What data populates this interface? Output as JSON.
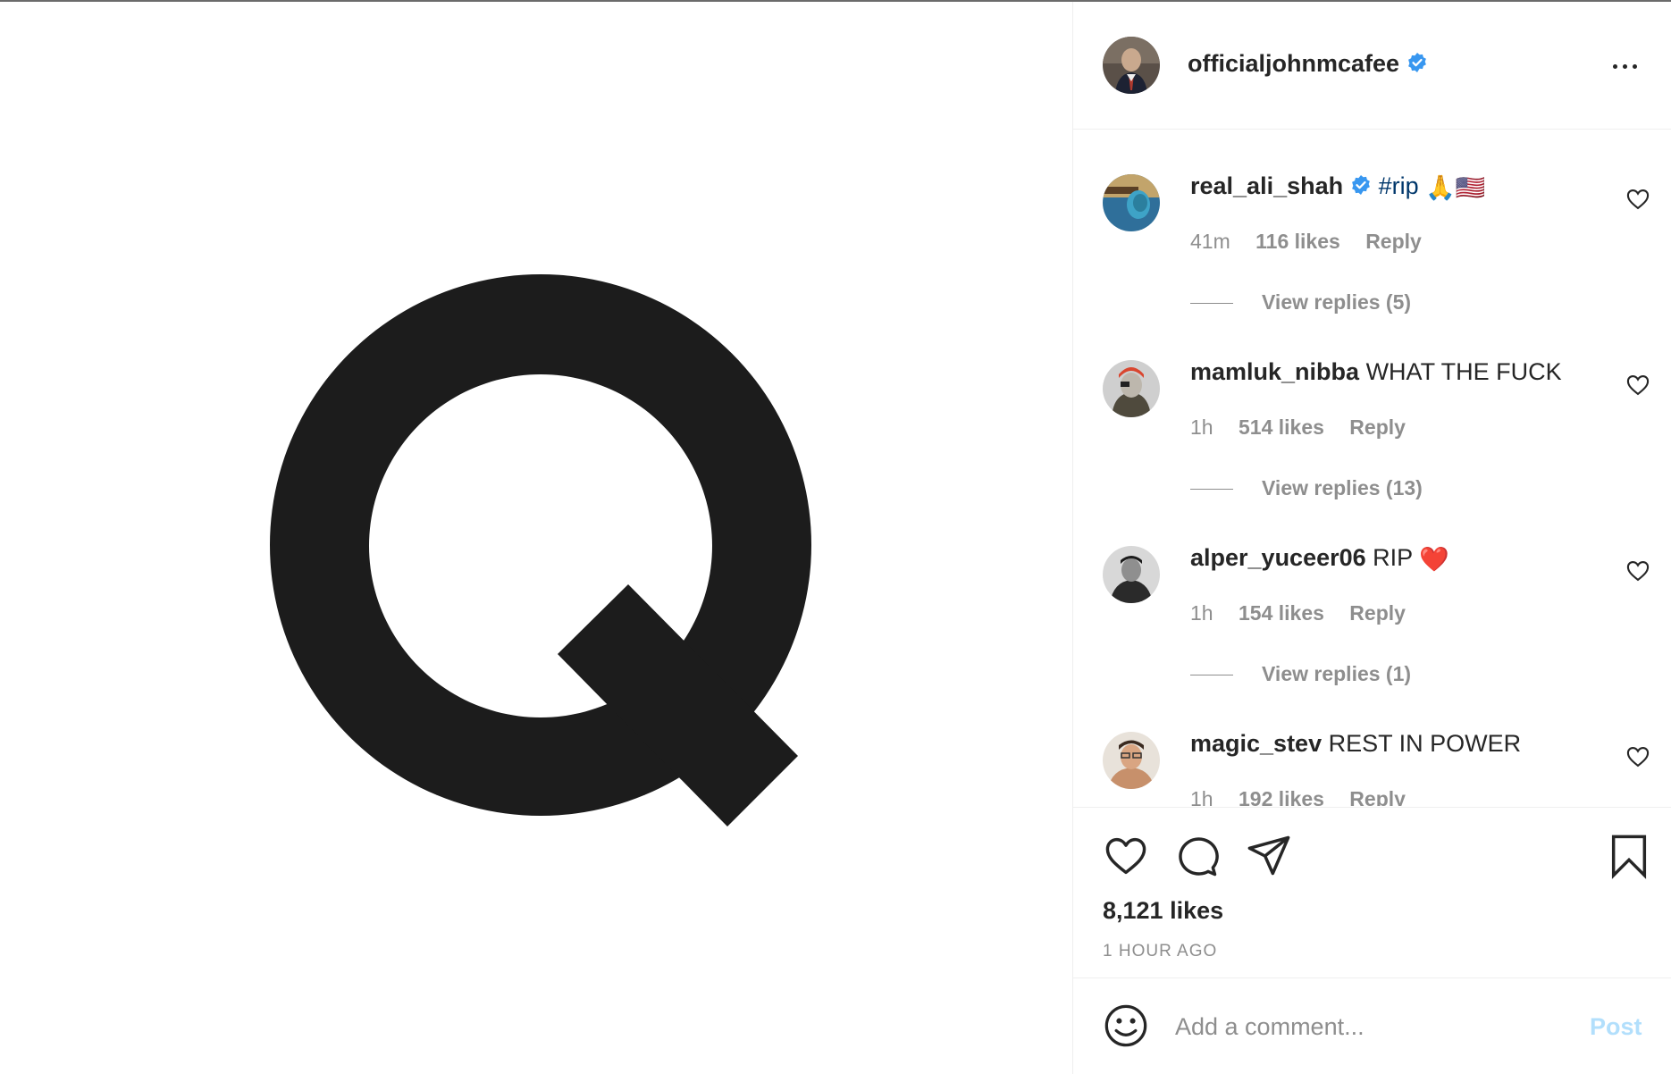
{
  "post": {
    "author": "officialjohnmcafee",
    "verified": true,
    "image_letter": "Q",
    "likes": "8,121 likes",
    "time_ago": "1 HOUR AGO"
  },
  "comments": [
    {
      "user": "real_ali_shah",
      "verified": true,
      "text": "#rip",
      "emoji": "🙏🇺🇸",
      "time": "41m",
      "likes": "116 likes",
      "reply": "Reply",
      "view_replies": "View replies (5)"
    },
    {
      "user": "mamluk_nibba",
      "verified": false,
      "text": "WHAT THE FUCK",
      "time": "1h",
      "likes": "514 likes",
      "reply": "Reply",
      "view_replies": "View replies (13)"
    },
    {
      "user": "alper_yuceer06",
      "verified": false,
      "text": "RIP",
      "emoji": "❤️",
      "time": "1h",
      "likes": "154 likes",
      "reply": "Reply",
      "view_replies": "View replies (1)"
    },
    {
      "user": "magic_stev",
      "verified": false,
      "text": "REST IN POWER",
      "time": "1h",
      "likes": "192 likes",
      "reply": "Reply"
    }
  ],
  "comment_box": {
    "placeholder": "Add a comment...",
    "post_label": "Post"
  },
  "icons": [
    "more-options-icon",
    "heart-icon",
    "comment-icon",
    "share-icon",
    "bookmark-icon",
    "emoji-icon",
    "verified-badge-icon"
  ],
  "colors": {
    "accent_blue": "#3897f0",
    "post_disabled": "#b2dffc",
    "meta_gray": "#8e8e8e",
    "text": "#262626"
  }
}
